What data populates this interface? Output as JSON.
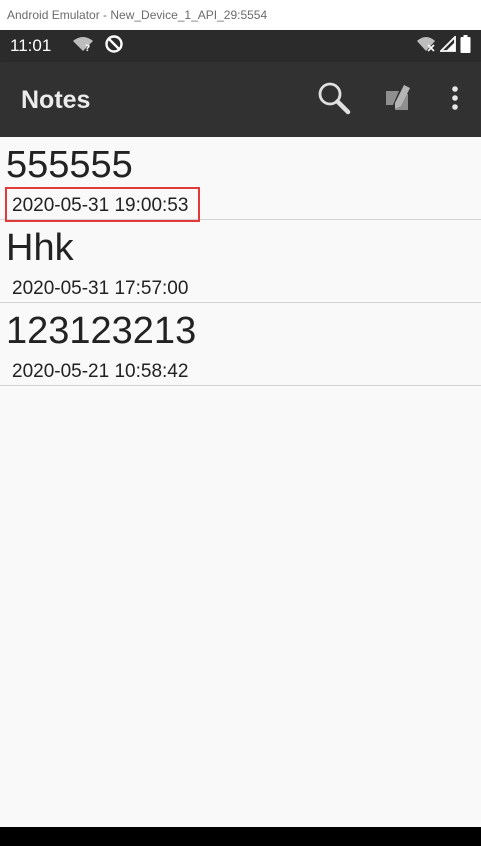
{
  "emulator": {
    "title": "Android Emulator - New_Device_1_API_29:5554"
  },
  "status_bar": {
    "time": "11:01",
    "icons_left": [
      "wifi-unknown-icon",
      "sync-disabled-icon"
    ],
    "icons_right": [
      "wifi-off-icon",
      "signal-icon",
      "battery-icon"
    ]
  },
  "app_bar": {
    "title": "Notes",
    "actions": [
      "search-icon",
      "new-note-icon",
      "more-options-icon"
    ]
  },
  "notes": [
    {
      "title": "555555",
      "date": "2020-05-31 19:00:53",
      "highlighted": true
    },
    {
      "title": "Hhk",
      "date": "2020-05-31 17:57:00",
      "highlighted": false
    },
    {
      "title": "123123213",
      "date": "2020-05-21 10:58:42",
      "highlighted": false
    }
  ],
  "colors": {
    "app_bar": "#313131",
    "status_bar": "#2b2b2b",
    "list_background": "#f9f9f9",
    "highlight": "#e03a3a"
  }
}
